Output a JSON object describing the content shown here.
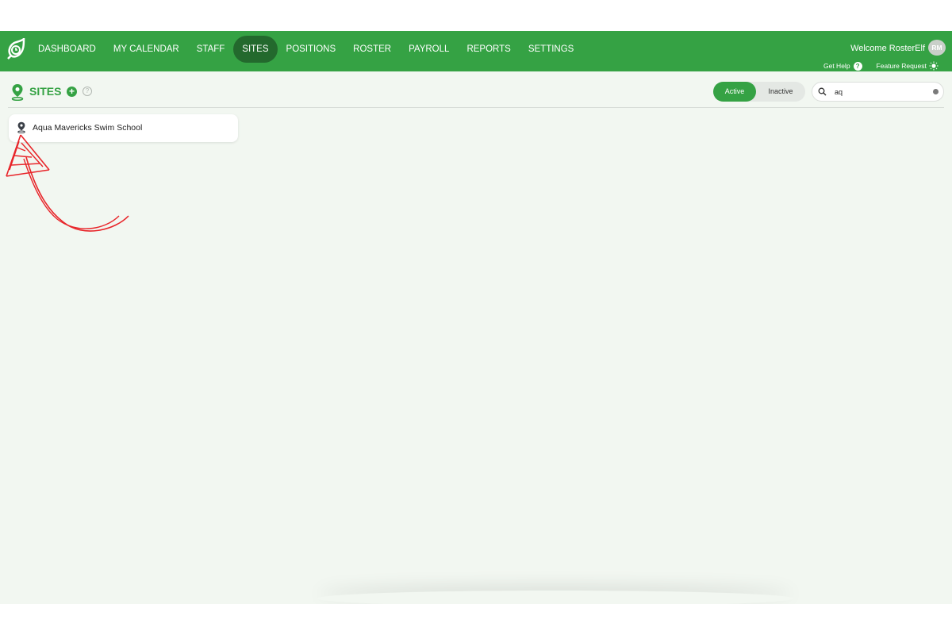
{
  "nav": {
    "items": [
      {
        "label": "DASHBOARD",
        "active": false
      },
      {
        "label": "MY CALENDAR",
        "active": false
      },
      {
        "label": "STAFF",
        "active": false
      },
      {
        "label": "SITES",
        "active": true
      },
      {
        "label": "POSITIONS",
        "active": false
      },
      {
        "label": "ROSTER",
        "active": false
      },
      {
        "label": "PAYROLL",
        "active": false
      },
      {
        "label": "REPORTS",
        "active": false
      },
      {
        "label": "SETTINGS",
        "active": false
      }
    ]
  },
  "header": {
    "welcome": "Welcome RosterElf",
    "avatar_initials": "RM",
    "get_help": "Get Help",
    "feature_request": "Feature Request"
  },
  "page": {
    "title": "SITES",
    "filter": {
      "active_label": "Active",
      "inactive_label": "Inactive",
      "selected": "Active"
    },
    "search": {
      "value": "aq"
    }
  },
  "sites": [
    {
      "name": "Aqua Mavericks Swim School"
    }
  ],
  "colors": {
    "brand_green": "#35a244",
    "active_nav": "#23692d",
    "annotation": "#e8252a"
  }
}
